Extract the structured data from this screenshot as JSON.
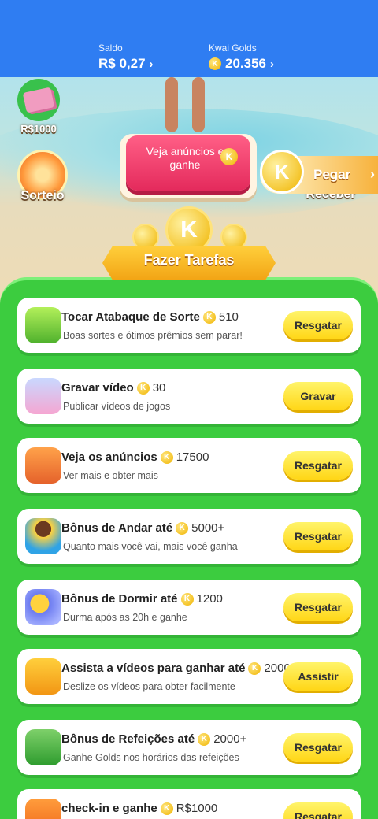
{
  "header": {
    "saldo_label": "Saldo",
    "saldo_value": "R$ 0,27",
    "golds_label": "Kwai Golds",
    "golds_value": "20.356"
  },
  "scene": {
    "cash_label": "R$1000",
    "sorteio_label": "Sorteio",
    "receber_label": "Receber",
    "pegar_label": "Pegar",
    "ads_button_label": "Veja anúncios e ganhe",
    "banner_label": "Fazer Tarefas"
  },
  "tasks": [
    {
      "title": "Tocar Atabaque de Sorte",
      "amount": "510",
      "subtitle": "Boas sortes e ótimos prêmios sem parar!",
      "button": "Resgatar",
      "icon": "drum-icon"
    },
    {
      "title": "Gravar vídeo",
      "amount": "30",
      "subtitle": "Publicar vídeos de jogos",
      "button": "Gravar",
      "icon": "video-icon"
    },
    {
      "title": "Veja os anúncios",
      "amount": "17500",
      "subtitle": "Ver mais e obter mais",
      "button": "Resgatar",
      "icon": "tv-icon"
    },
    {
      "title": "Bônus de Andar até",
      "amount": "5000+",
      "subtitle": "Quanto mais você vai, mais você ganha",
      "button": "Resgatar",
      "icon": "walking-boy-icon"
    },
    {
      "title": "Bônus de Dormir até",
      "amount": "1200",
      "subtitle": "Durma após as 20h e ganhe",
      "button": "Resgatar",
      "icon": "moon-sleep-icon"
    },
    {
      "title": "Assista a vídeos para ganhar até",
      "amount": "2000",
      "subtitle": "Deslize os vídeos para obter facilmente",
      "button": "Assistir",
      "icon": "camera-icon"
    },
    {
      "title": "Bônus de Refeições até",
      "amount": "2000+",
      "subtitle": "Ganhe Golds nos horários das refeições",
      "button": "Resgatar",
      "icon": "meal-calendar-icon"
    },
    {
      "title": "check-in e ganhe",
      "amount": "R$1000",
      "subtitle": "",
      "button": "Resgatar",
      "icon": "checkin-calendar-icon"
    }
  ]
}
